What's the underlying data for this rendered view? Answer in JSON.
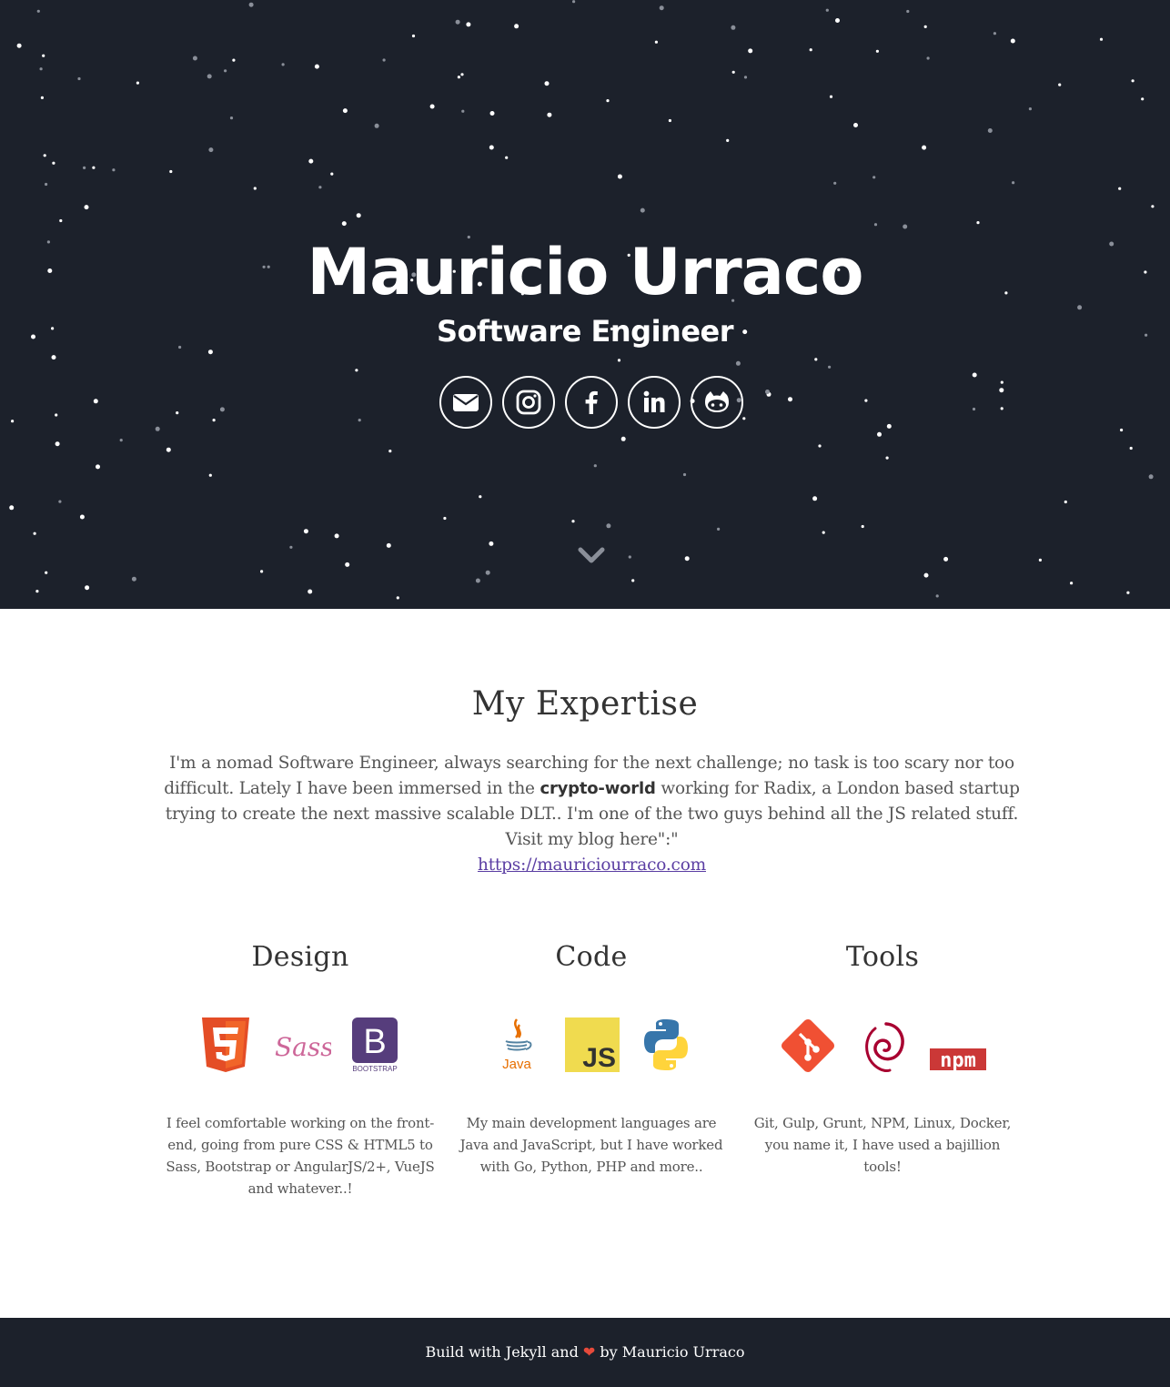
{
  "hero": {
    "title": "Mauricio Urraco",
    "subtitle": "Software Engineer",
    "socials": [
      {
        "name": "email",
        "icon": "envelope-icon"
      },
      {
        "name": "instagram",
        "icon": "instagram-icon"
      },
      {
        "name": "facebook",
        "icon": "facebook-icon"
      },
      {
        "name": "linkedin",
        "icon": "linkedin-icon"
      },
      {
        "name": "github",
        "icon": "github-icon"
      }
    ],
    "scroll_icon": "chevron-down-icon",
    "background_color": "#1c212b"
  },
  "expertise": {
    "title": "My Expertise",
    "text_before": "I'm a nomad Software Engineer, always searching for the next challenge; no task is too scary nor too difficult. Lately I have been immersed in the ",
    "bold": "crypto-world",
    "text_after": " working for Radix, a London based startup trying to create the next massive scalable DLT.. I'm one of the two guys behind all the JS related stuff. Visit my blog here\":\"",
    "link": "https://mauriciourraco.com"
  },
  "columns": [
    {
      "title": "Design",
      "icons": [
        "html5-icon",
        "sass-icon",
        "bootstrap-icon"
      ],
      "text": "I feel comfortable working on the front-end, going from pure CSS & HTML5 to Sass, Bootstrap or AngularJS/2+, VueJS and whatever..!"
    },
    {
      "title": "Code",
      "icons": [
        "java-icon",
        "javascript-icon",
        "python-icon"
      ],
      "text": "My main development languages are Java and JavaScript, but I have worked with Go, Python, PHP and more.."
    },
    {
      "title": "Tools",
      "icons": [
        "git-icon",
        "debian-icon",
        "npm-icon"
      ],
      "text": "Git, Gulp, Grunt, NPM, Linux, Docker, you name it, I have used a bajillion tools!"
    }
  ],
  "icon_labels": {
    "bootstrap": "BOOTSTRAP",
    "bootstrap_letter": "B",
    "java": "Java",
    "js": "JS",
    "npm": "npm",
    "sass": "Sass"
  },
  "footer": {
    "text_before": "Build with Jekyll and ",
    "heart": "❤",
    "text_after": " by Mauricio Urraco"
  },
  "colors": {
    "dark": "#1c212b",
    "link": "#5b3ea3",
    "heart": "#e64a3b",
    "html5": "#e44d26",
    "sass": "#cd6799",
    "bootstrap": "#563d7c",
    "js": "#f0db4f",
    "git": "#f05033",
    "debian": "#a80030",
    "npm": "#cb3837"
  }
}
